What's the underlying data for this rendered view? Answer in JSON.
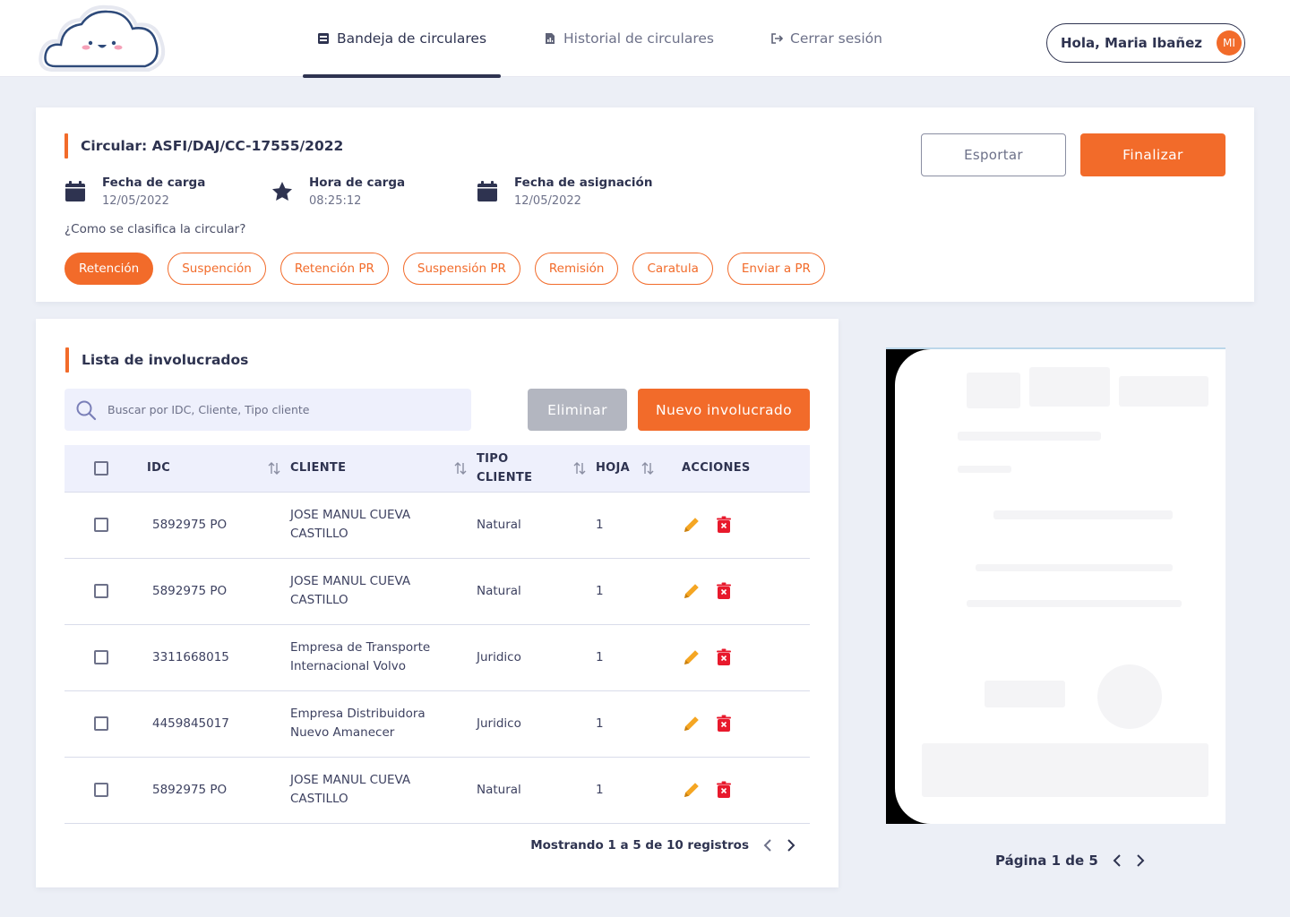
{
  "nav": {
    "items": [
      {
        "label": "Bandeja de circulares",
        "icon": "inbox-icon",
        "active": true
      },
      {
        "label": "Historial de circulares",
        "icon": "document-chart-icon",
        "active": false
      },
      {
        "label": "Cerrar sesión",
        "icon": "logout-icon",
        "active": false
      }
    ],
    "user_greeting": "Hola, Maria Ibañez",
    "user_initials": "MI"
  },
  "circular": {
    "title": "Circular: ASFI/DAJ/CC-17555/2022",
    "meta": [
      {
        "label": "Fecha de carga",
        "value": "12/05/2022",
        "icon": "calendar-icon"
      },
      {
        "label": "Hora de carga",
        "value": "08:25:12",
        "icon": "star-icon"
      },
      {
        "label": "Fecha de asignación",
        "value": "12/05/2022",
        "icon": "calendar-icon"
      }
    ],
    "question": "¿Como se clasifica la circular?",
    "classifications": [
      "Retención",
      "Suspención",
      "Retención PR",
      "Suspensión PR",
      "Remisión",
      "Caratula",
      "Enviar a PR"
    ],
    "selected_classification": "Retención",
    "export_label": "Esportar",
    "finish_label": "Finalizar"
  },
  "involucrados": {
    "title": "Lista de involucrados",
    "search_placeholder": "Buscar por IDC, Cliente, Tipo cliente",
    "delete_label": "Eliminar",
    "new_label": "Nuevo involucrado",
    "columns": [
      "IDC",
      "CLIENTE",
      "TIPO CLIENTE",
      "HOJA",
      "ACCIONES"
    ],
    "rows": [
      {
        "idc": "5892975 PO",
        "cliente": "JOSE MANUL CUEVA CASTILLO",
        "tipo": "Natural",
        "hoja": "1"
      },
      {
        "idc": "5892975 PO",
        "cliente": "JOSE MANUL CUEVA CASTILLO",
        "tipo": "Natural",
        "hoja": "1"
      },
      {
        "idc": "3311668015",
        "cliente": "Empresa de Transporte Internacional Volvo",
        "tipo": "Juridico",
        "hoja": "1"
      },
      {
        "idc": "4459845017",
        "cliente": "Empresa Distribuidora Nuevo Amanecer",
        "tipo": "Juridico",
        "hoja": "1"
      },
      {
        "idc": "5892975 PO",
        "cliente": "JOSE MANUL CUEVA CASTILLO",
        "tipo": "Natural",
        "hoja": "1"
      }
    ],
    "pagination": "Mostrando 1 a 5 de 10 registros"
  },
  "preview": {
    "page_label": "Página 1 de 5"
  },
  "colors": {
    "accent": "#f26b2a",
    "navy": "#2e3350",
    "edit": "#f5a623",
    "delete": "#e8192c"
  }
}
